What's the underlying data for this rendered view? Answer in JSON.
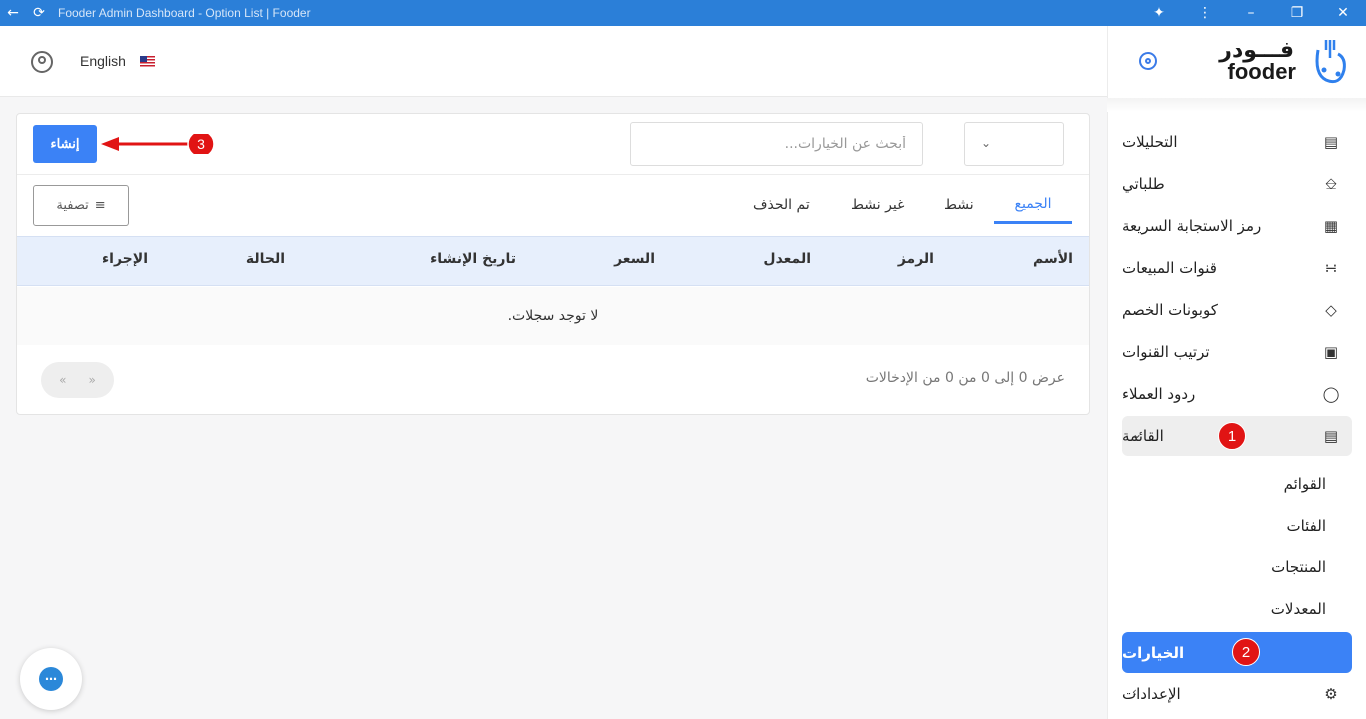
{
  "window": {
    "title": "Fooder Admin Dashboard - Option List | Fooder"
  },
  "brand": {
    "logo_ar": "فـــودر",
    "logo_en": "fooder",
    "accent": "#3b82f6"
  },
  "header": {
    "language": "English"
  },
  "sidebar": {
    "items": [
      {
        "label": "التحليلات",
        "icon": "chart-icon"
      },
      {
        "label": "طلباتي",
        "icon": "bell-tray-icon"
      },
      {
        "label": "رمز الاستجابة السريعة",
        "icon": "qr-icon"
      },
      {
        "label": "قنوات المبيعات",
        "icon": "rss-icon"
      },
      {
        "label": "كوبونات الخصم",
        "icon": "tag-icon"
      },
      {
        "label": "ترتيب القنوات",
        "icon": "store-icon"
      },
      {
        "label": "ردود العملاء",
        "icon": "chat-bubble-icon"
      },
      {
        "label": "القائمة",
        "icon": "clipboard-icon"
      }
    ],
    "submenu": [
      "القوائم",
      "الفئات",
      "المنتجات",
      "المعدلات",
      "الخيارات"
    ],
    "settings": {
      "label": "الإعدادات",
      "icon": "gear-icon"
    },
    "badges": [
      "1",
      "2"
    ]
  },
  "toolbar": {
    "create_label": "إنشاء",
    "search_placeholder": "أبحث عن الخيارات...",
    "filter_label": "تصفية",
    "step_badge": "3"
  },
  "tabs": [
    "الجميع",
    "نشط",
    "غير نشط",
    "تم الحذف"
  ],
  "table": {
    "columns": [
      "الأسم",
      "الرمز",
      "المعدل",
      "السعر",
      "تاريخ الإنشاء",
      "الحالة",
      "الإجراء"
    ],
    "empty_message": "لا توجد سجلات."
  },
  "pagination": {
    "summary": "عرض 0 إلى 0 من 0 من الإدخالات",
    "prev": "«",
    "next": "»"
  }
}
